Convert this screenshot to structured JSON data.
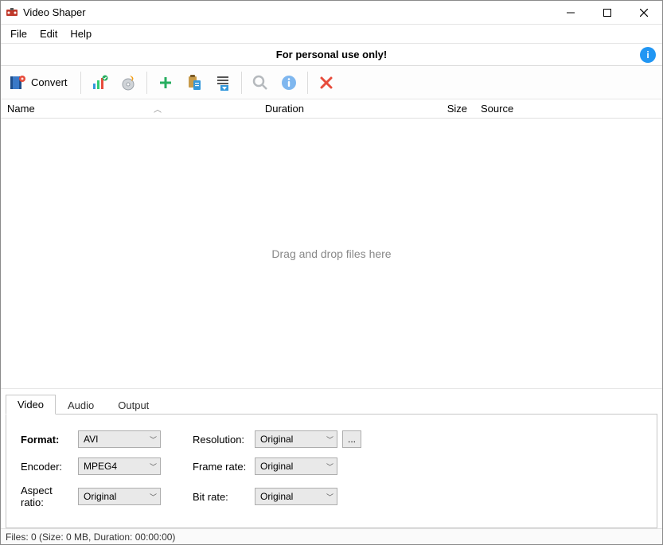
{
  "window": {
    "title": "Video Shaper"
  },
  "menu": {
    "file": "File",
    "edit": "Edit",
    "help": "Help"
  },
  "banner": {
    "message": "For personal use only!"
  },
  "toolbar": {
    "convert_label": "Convert"
  },
  "columns": {
    "name": "Name",
    "duration": "Duration",
    "size": "Size",
    "source": "Source"
  },
  "list": {
    "empty_hint": "Drag and drop files here"
  },
  "tabs": {
    "video": "Video",
    "audio": "Audio",
    "output": "Output"
  },
  "video_panel": {
    "format_label": "Format:",
    "format_value": "AVI",
    "encoder_label": "Encoder:",
    "encoder_value": "MPEG4",
    "aspect_label": "Aspect ratio:",
    "aspect_value": "Original",
    "resolution_label": "Resolution:",
    "resolution_value": "Original",
    "framerate_label": "Frame rate:",
    "framerate_value": "Original",
    "bitrate_label": "Bit rate:",
    "bitrate_value": "Original",
    "more_button": "..."
  },
  "status": {
    "text": "Files: 0 (Size: 0 MB, Duration: 00:00:00)"
  }
}
